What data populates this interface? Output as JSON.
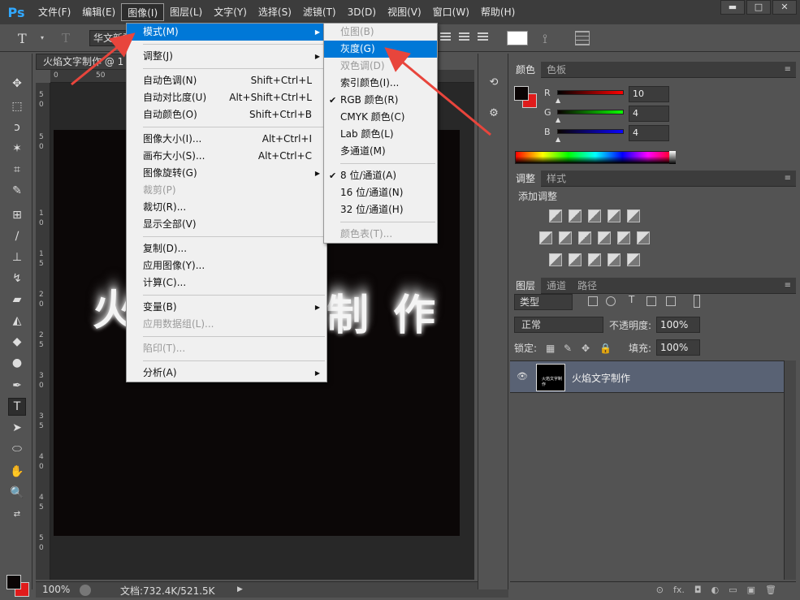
{
  "app": {
    "logo": "Ps"
  },
  "menubar": {
    "items": [
      "文件(F)",
      "编辑(E)",
      "图像(I)",
      "图层(L)",
      "文字(Y)",
      "选择(S)",
      "滤镜(T)",
      "3D(D)",
      "视图(V)",
      "窗口(W)",
      "帮助(H)"
    ],
    "active_index": 2
  },
  "window_controls": {
    "minimize": "▬",
    "maximize": "□",
    "close": "✕"
  },
  "options": {
    "tool_glyph": "T",
    "font_family": "华文新魏"
  },
  "document": {
    "tab_title": "火焰文字制作 @ 1",
    "ruler_labels": [
      "0",
      "50"
    ],
    "ruler_v_labels": [
      "5",
      "0",
      "5",
      "0",
      "1",
      "0",
      "1",
      "5",
      "2",
      "0",
      "2",
      "5",
      "3",
      "0",
      "3",
      "5",
      "4",
      "0",
      "4",
      "5",
      "5",
      "0"
    ],
    "canvas_text_left": "火",
    "canvas_text_right": "制 作",
    "zoom": "100%",
    "doc_info": "文档:732.4K/521.5K"
  },
  "image_menu": {
    "items": [
      {
        "label": "模式(M)",
        "shortcut": "",
        "submenu": true,
        "highlighted": true,
        "disabled": false
      },
      {
        "sep": true
      },
      {
        "label": "调整(J)",
        "shortcut": "",
        "submenu": true,
        "disabled": false
      },
      {
        "sep": true
      },
      {
        "label": "自动色调(N)",
        "shortcut": "Shift+Ctrl+L",
        "disabled": false
      },
      {
        "label": "自动对比度(U)",
        "shortcut": "Alt+Shift+Ctrl+L",
        "disabled": false
      },
      {
        "label": "自动颜色(O)",
        "shortcut": "Shift+Ctrl+B",
        "disabled": false
      },
      {
        "sep": true
      },
      {
        "label": "图像大小(I)...",
        "shortcut": "Alt+Ctrl+I",
        "disabled": false
      },
      {
        "label": "画布大小(S)...",
        "shortcut": "Alt+Ctrl+C",
        "disabled": false
      },
      {
        "label": "图像旋转(G)",
        "shortcut": "",
        "submenu": true,
        "disabled": false
      },
      {
        "label": "裁剪(P)",
        "shortcut": "",
        "disabled": true
      },
      {
        "label": "裁切(R)...",
        "shortcut": "",
        "disabled": false
      },
      {
        "label": "显示全部(V)",
        "shortcut": "",
        "disabled": false
      },
      {
        "sep": true
      },
      {
        "label": "复制(D)...",
        "shortcut": "",
        "disabled": false
      },
      {
        "label": "应用图像(Y)...",
        "shortcut": "",
        "disabled": false
      },
      {
        "label": "计算(C)...",
        "shortcut": "",
        "disabled": false
      },
      {
        "sep": true
      },
      {
        "label": "变量(B)",
        "shortcut": "",
        "submenu": true,
        "disabled": false
      },
      {
        "label": "应用数据组(L)...",
        "shortcut": "",
        "disabled": true
      },
      {
        "sep": true
      },
      {
        "label": "陷印(T)...",
        "shortcut": "",
        "disabled": true
      },
      {
        "sep": true
      },
      {
        "label": "分析(A)",
        "shortcut": "",
        "submenu": true,
        "disabled": false
      }
    ]
  },
  "mode_menu": {
    "items": [
      {
        "label": "位图(B)",
        "disabled": true
      },
      {
        "label": "灰度(G)",
        "highlighted": true
      },
      {
        "label": "双色调(D)",
        "disabled": true
      },
      {
        "label": "索引颜色(I)..."
      },
      {
        "label": "RGB 颜色(R)",
        "checked": true
      },
      {
        "label": "CMYK 颜色(C)"
      },
      {
        "label": "Lab 颜色(L)"
      },
      {
        "label": "多通道(M)"
      },
      {
        "sep": true
      },
      {
        "label": "8 位/通道(A)",
        "checked": true
      },
      {
        "label": "16 位/通道(N)"
      },
      {
        "label": "32 位/通道(H)"
      },
      {
        "sep": true
      },
      {
        "label": "颜色表(T)...",
        "disabled": true
      }
    ]
  },
  "color_panel": {
    "tabs": [
      "颜色",
      "色板"
    ],
    "r_label": "R",
    "g_label": "G",
    "b_label": "B",
    "r": "10",
    "g": "4",
    "b": "4",
    "fg_color": "#0a0404",
    "bg_color": "#e01b1b"
  },
  "adjust_panel": {
    "tabs": [
      "调整",
      "样式"
    ],
    "title": "添加调整"
  },
  "layers_panel": {
    "tabs": [
      "图层",
      "通道",
      "路径"
    ],
    "filter": "类型",
    "blend_mode": "正常",
    "opacity_label": "不透明度:",
    "opacity": "100%",
    "lock_label": "锁定:",
    "fill_label": "填充:",
    "fill": "100%",
    "layer_name": "火焰文字制作",
    "footer_icons": [
      "⊙",
      "fx.",
      "◘",
      "◐",
      "▭",
      "▣",
      "🗑"
    ]
  },
  "colors": {
    "menu_highlight": "#0078d7",
    "annotation_arrow": "#e8453c"
  }
}
